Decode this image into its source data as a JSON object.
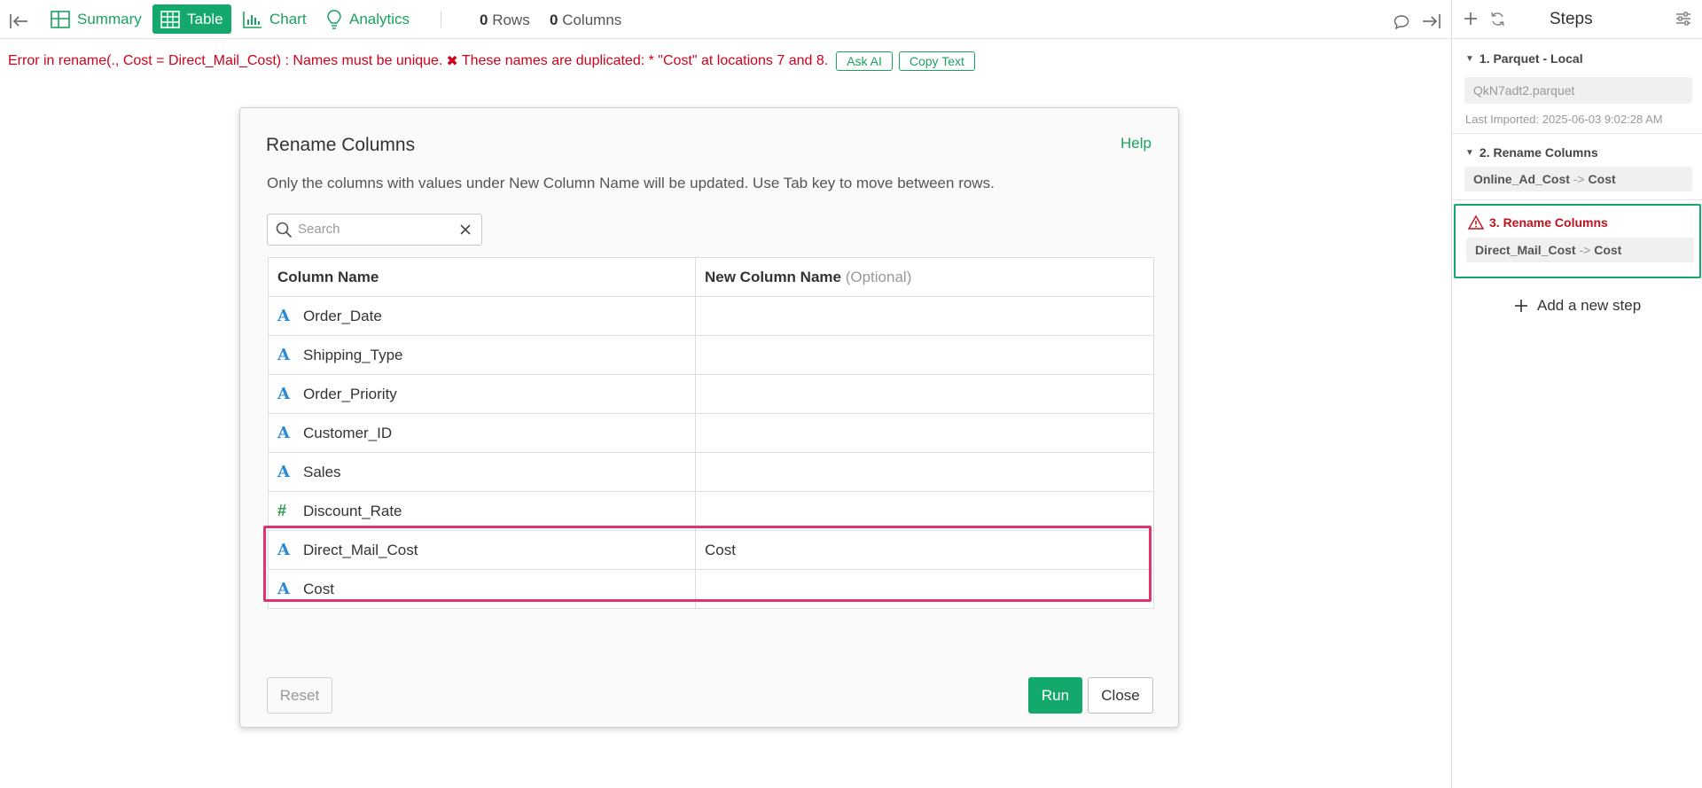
{
  "toolbar": {
    "tabs": [
      {
        "label": "Summary",
        "icon": "summary-grid-icon"
      },
      {
        "label": "Table",
        "icon": "table-icon"
      },
      {
        "label": "Chart",
        "icon": "chart-icon"
      },
      {
        "label": "Analytics",
        "icon": "lightbulb-icon"
      }
    ],
    "active_tab": "Table",
    "rows_count": "0",
    "rows_label": "Rows",
    "cols_count": "0",
    "cols_label": "Columns"
  },
  "error": {
    "message_1": "Error in rename(., Cost = Direct_Mail_Cost) : Names must be unique.",
    "message_2": "These names are duplicated: * \"Cost\" at locations 7 and 8.",
    "ask_ai_label": "Ask AI",
    "copy_text_label": "Copy Text"
  },
  "modal": {
    "title": "Rename Columns",
    "help_label": "Help",
    "description": "Only the columns with values under New Column Name will be updated. Use Tab key to move between rows.",
    "search_placeholder": "Search",
    "col_header_1": "Column Name",
    "col_header_2": "New Column Name",
    "col_header_2_note": "(Optional)",
    "rows": [
      {
        "type": "A",
        "name": "Order_Date",
        "new_name": ""
      },
      {
        "type": "A",
        "name": "Shipping_Type",
        "new_name": ""
      },
      {
        "type": "A",
        "name": "Order_Priority",
        "new_name": ""
      },
      {
        "type": "A",
        "name": "Customer_ID",
        "new_name": ""
      },
      {
        "type": "A",
        "name": "Sales",
        "new_name": ""
      },
      {
        "type": "#",
        "name": "Discount_Rate",
        "new_name": ""
      },
      {
        "type": "A",
        "name": "Direct_Mail_Cost",
        "new_name": "Cost"
      },
      {
        "type": "A",
        "name": "Cost",
        "new_name": ""
      }
    ],
    "reset_label": "Reset",
    "run_label": "Run",
    "close_label": "Close"
  },
  "steps_panel": {
    "title": "Steps",
    "steps": [
      {
        "label": "1. Parquet - Local",
        "value": "QkN7adt2.parquet",
        "sub": "Last Imported: 2025-06-03 9:02:28 AM"
      },
      {
        "label": "2. Rename Columns",
        "from": "Online_Ad_Cost",
        "arrow": "->",
        "to": "Cost"
      },
      {
        "label": "3. Rename Columns",
        "from": "Direct_Mail_Cost",
        "arrow": "->",
        "to": "Cost"
      }
    ],
    "add_step_label": "Add a new step"
  },
  "colors": {
    "accent": "#13a86c",
    "error": "#d0021b",
    "highlight": "#e3336f"
  }
}
